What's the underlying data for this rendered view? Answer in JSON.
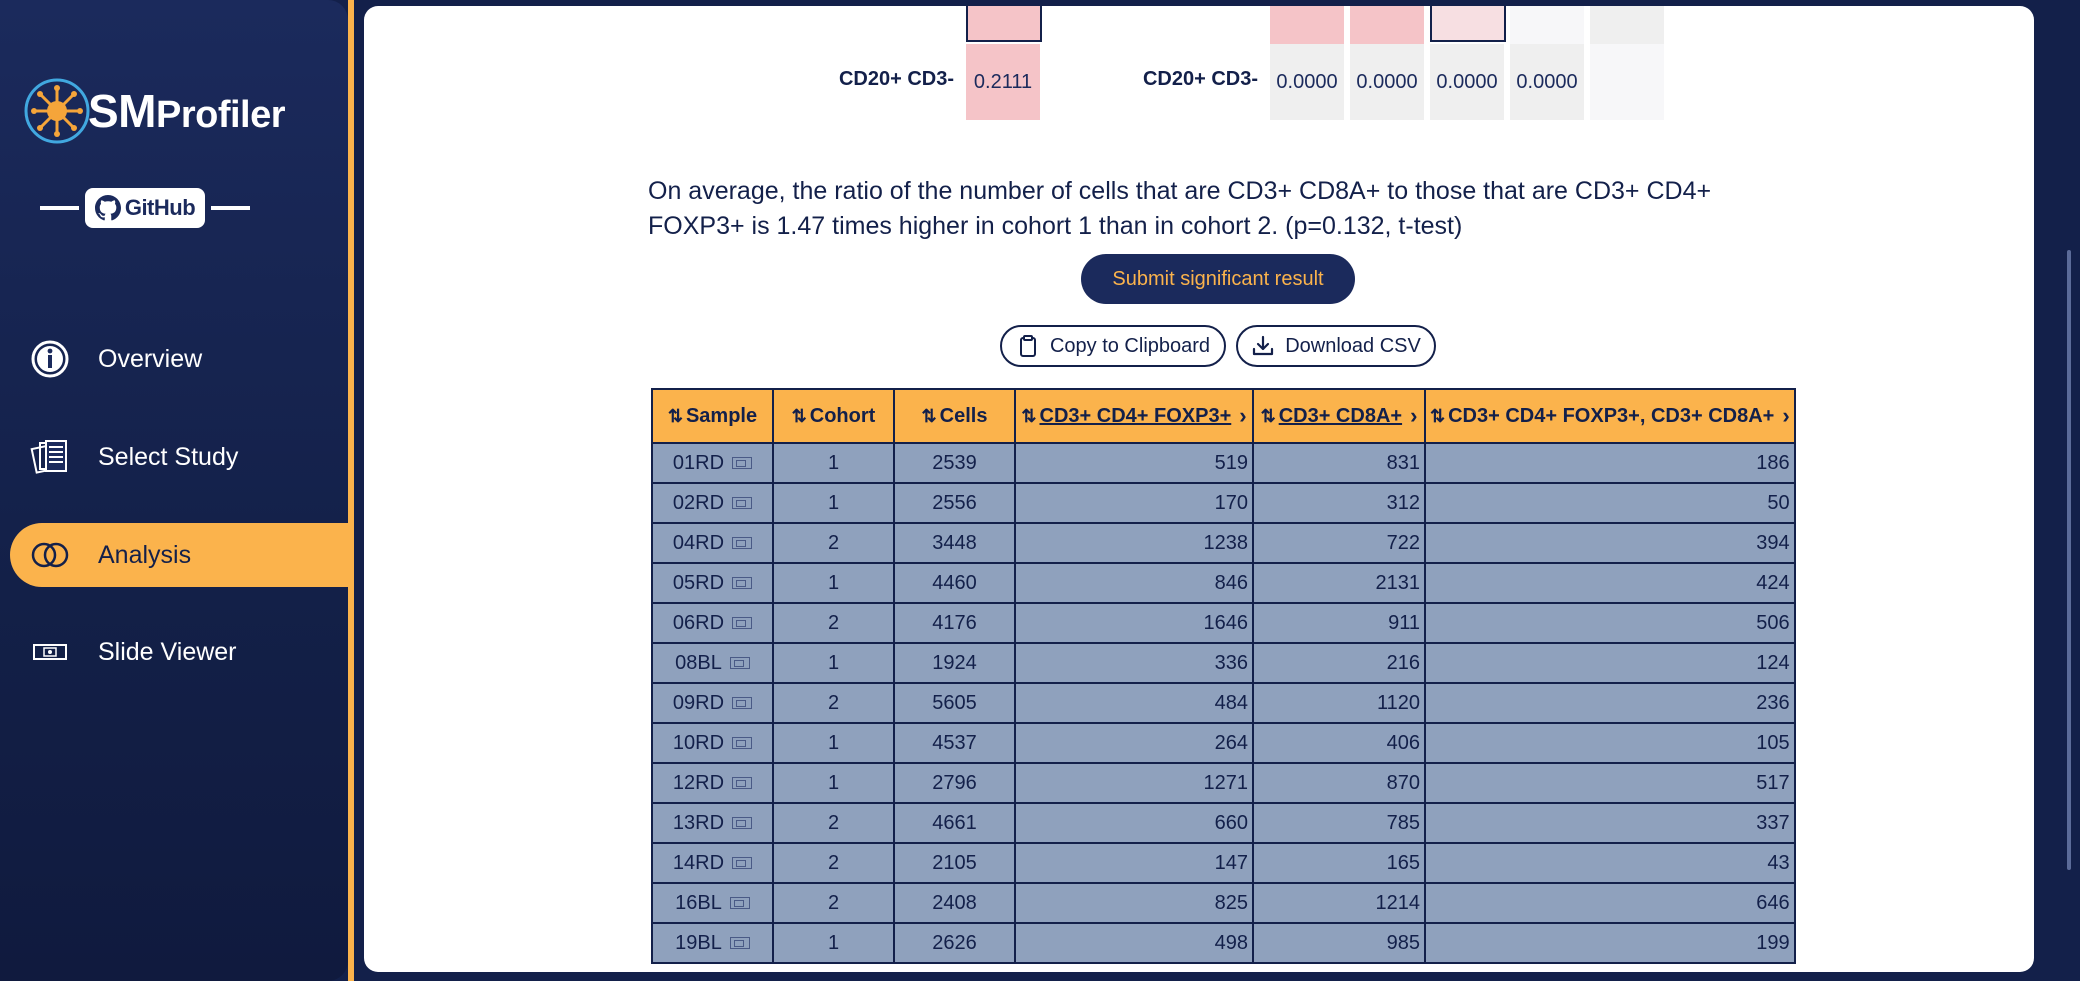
{
  "sidebar": {
    "logo_text_big": "SM",
    "logo_text_small": "Profiler",
    "github_label": "GitHub",
    "items": [
      {
        "label": "Overview",
        "icon": "info-icon",
        "active": false
      },
      {
        "label": "Select Study",
        "icon": "documents-icon",
        "active": false
      },
      {
        "label": "Analysis",
        "icon": "venn-icon",
        "active": true
      },
      {
        "label": "Slide Viewer",
        "icon": "slide-icon",
        "active": false
      }
    ]
  },
  "heatmap": {
    "row_label_left": "CD20+ CD3-",
    "row_label_right": "CD20+ CD3-",
    "left_value": "0.2111",
    "right_values": [
      "0.0000",
      "0.0000",
      "0.0000",
      "0.0000"
    ]
  },
  "summary_text": "On average, the ratio of the number of cells that are CD3+ CD8A+ to those that are CD3+ CD4+ FOXP3+ is 1.47 times higher in cohort 1 than in cohort 2. (p=0.132, t-test)",
  "buttons": {
    "submit": "Submit significant result",
    "copy": "Copy to Clipboard",
    "download": "Download CSV"
  },
  "table": {
    "columns": [
      "Sample",
      "Cohort",
      "Cells",
      "CD3+ CD4+ FOXP3+",
      "CD3+ CD8A+",
      "CD3+ CD4+ FOXP3+, CD3+ CD8A+"
    ],
    "rows": [
      [
        "01RD",
        "1",
        "2539",
        "519",
        "831",
        "186"
      ],
      [
        "02RD",
        "1",
        "2556",
        "170",
        "312",
        "50"
      ],
      [
        "04RD",
        "2",
        "3448",
        "1238",
        "722",
        "394"
      ],
      [
        "05RD",
        "1",
        "4460",
        "846",
        "2131",
        "424"
      ],
      [
        "06RD",
        "2",
        "4176",
        "1646",
        "911",
        "506"
      ],
      [
        "08BL",
        "1",
        "1924",
        "336",
        "216",
        "124"
      ],
      [
        "09RD",
        "2",
        "5605",
        "484",
        "1120",
        "236"
      ],
      [
        "10RD",
        "1",
        "4537",
        "264",
        "406",
        "105"
      ],
      [
        "12RD",
        "1",
        "2796",
        "1271",
        "870",
        "517"
      ],
      [
        "13RD",
        "2",
        "4661",
        "660",
        "785",
        "337"
      ],
      [
        "14RD",
        "2",
        "2105",
        "147",
        "165",
        "43"
      ],
      [
        "16BL",
        "2",
        "2408",
        "825",
        "1214",
        "646"
      ],
      [
        "19BL",
        "1",
        "2626",
        "498",
        "985",
        "199"
      ]
    ]
  },
  "colors": {
    "accent": "#fbb34c",
    "navy": "#1b2a5c",
    "table_cell": "#8fa1bd",
    "heat_pink": "#f5c4c8",
    "heat_gray": "#efefef"
  }
}
